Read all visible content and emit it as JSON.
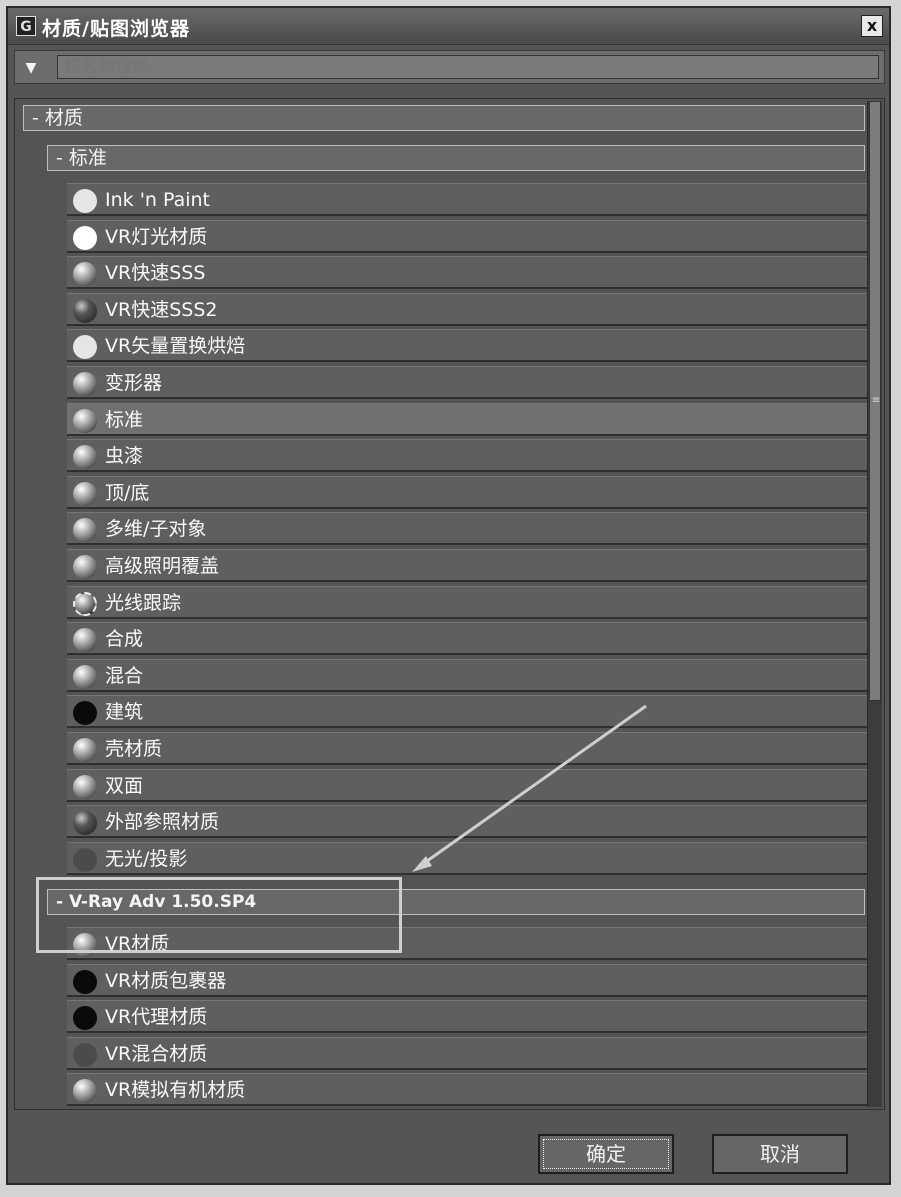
{
  "window": {
    "title": "材质/贴图浏览器",
    "app_icon": "app-logo-icon",
    "close_glyph": "x"
  },
  "search": {
    "toggle_icon": "triangle-down-icon",
    "placeholder": "按名称搜索..."
  },
  "groups": {
    "materials": "- 材质",
    "standard": "- 标准",
    "vray": "- V-Ray Adv 1.50.SP4"
  },
  "standard_items": [
    {
      "label": "Ink 'n Paint",
      "icon": "flat-light-sphere-icon"
    },
    {
      "label": "VR灯光材质",
      "icon": "white-sphere-icon"
    },
    {
      "label": "VR快速SSS",
      "icon": "sphere-icon"
    },
    {
      "label": "VR快速SSS2",
      "icon": "dark-sphere-icon"
    },
    {
      "label": "VR矢量置换烘焙",
      "icon": "flat-light-sphere-icon"
    },
    {
      "label": "变形器",
      "icon": "sphere-icon"
    },
    {
      "label": "标准",
      "icon": "sphere-icon",
      "selected": true
    },
    {
      "label": "虫漆",
      "icon": "sphere-icon"
    },
    {
      "label": "顶/底",
      "icon": "sphere-icon"
    },
    {
      "label": "多维/子对象",
      "icon": "sphere-icon"
    },
    {
      "label": "高级照明覆盖",
      "icon": "sphere-icon"
    },
    {
      "label": "光线跟踪",
      "icon": "raytrace-sphere-icon"
    },
    {
      "label": "合成",
      "icon": "sphere-icon"
    },
    {
      "label": "混合",
      "icon": "sphere-icon"
    },
    {
      "label": "建筑",
      "icon": "black-sphere-icon"
    },
    {
      "label": "壳材质",
      "icon": "sphere-icon"
    },
    {
      "label": "双面",
      "icon": "sphere-icon"
    },
    {
      "label": "外部参照材质",
      "icon": "dark-sphere-icon"
    },
    {
      "label": "无光/投影",
      "icon": "checker-square-icon"
    }
  ],
  "vray_items": [
    {
      "label": "VR材质",
      "icon": "sphere-icon"
    },
    {
      "label": "VR材质包裹器",
      "icon": "black-sphere-icon"
    },
    {
      "label": "VR代理材质",
      "icon": "black-sphere-icon"
    },
    {
      "label": "VR混合材质",
      "icon": "checker-square-icon"
    },
    {
      "label": "VR模拟有机材质",
      "icon": "sphere-icon"
    }
  ],
  "buttons": {
    "ok": "确定",
    "cancel": "取消"
  },
  "scrollbar": {
    "grip_glyph": "≡"
  }
}
